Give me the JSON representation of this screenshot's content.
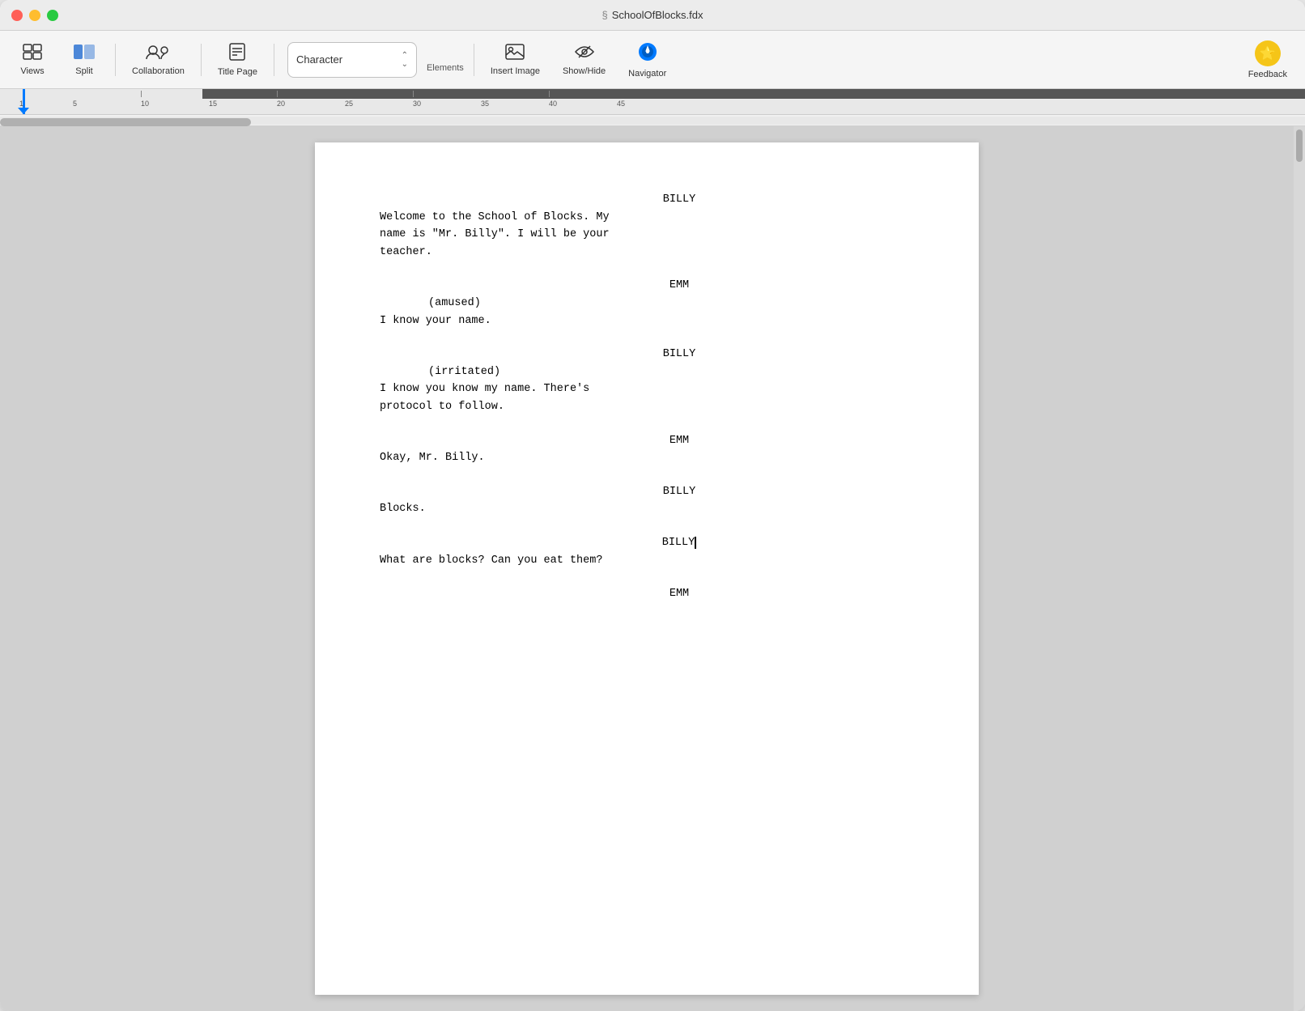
{
  "window": {
    "title": "SchoolOfBlocks.fdx",
    "title_icon": "§"
  },
  "toolbar": {
    "views_label": "Views",
    "split_label": "Split",
    "collaboration_label": "Collaboration",
    "title_page_label": "Title Page",
    "elements_label": "Elements",
    "elements_selected": "Character",
    "insert_image_label": "Insert Image",
    "show_hide_label": "Show/Hide",
    "navigator_label": "Navigator",
    "feedback_label": "Feedback"
  },
  "script": {
    "blocks": [
      {
        "id": "block1",
        "character": "BILLY",
        "parenthetical": null,
        "dialogue": "Welcome to the School of Blocks. My\nname is \"Mr. Billy\". I will be your\nteacher."
      },
      {
        "id": "block2",
        "character": "EMM",
        "parenthetical": "(amused)",
        "dialogue": "I know your name."
      },
      {
        "id": "block3",
        "character": "BILLY",
        "parenthetical": "(irritated)",
        "dialogue": "I know you know my name. There's\nprotocol to follow."
      },
      {
        "id": "block4",
        "character": "EMM",
        "parenthetical": null,
        "dialogue": "Okay, Mr. Billy."
      },
      {
        "id": "block5",
        "character": "BILLY",
        "parenthetical": null,
        "dialogue": "Blocks."
      },
      {
        "id": "block6",
        "character": "BILLY",
        "parenthetical": null,
        "dialogue": "What are blocks? Can you eat them?",
        "cursor": true
      },
      {
        "id": "block7",
        "character": "EMM",
        "parenthetical": null,
        "dialogue": null
      }
    ]
  },
  "ruler": {
    "numbers": [
      1,
      5,
      10,
      15,
      20,
      25,
      30,
      35,
      40,
      45
    ],
    "unit": "inches"
  },
  "colors": {
    "accent_blue": "#007aff",
    "toolbar_bg": "#f5f5f5",
    "page_bg": "#ffffff",
    "feedback_yellow": "#f5c518"
  }
}
